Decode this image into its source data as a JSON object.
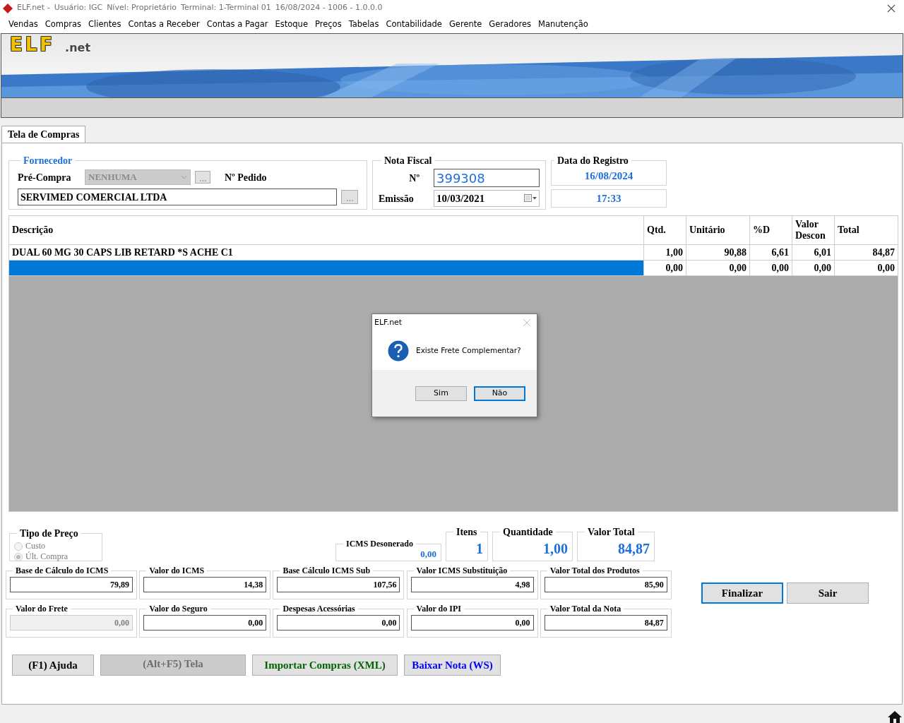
{
  "window": {
    "title_parts": [
      "ELF.net -",
      "Usuário: IGC",
      "Nível: Proprietário",
      "Terminal: 1-Terminal 01",
      "16/08/2024 - 1006 - 1.0.0.0"
    ]
  },
  "menu": [
    "Vendas",
    "Compras",
    "Clientes",
    "Contas a Receber",
    "Contas a Pagar",
    "Estoque",
    "Preços",
    "Tabelas",
    "Contabilidade",
    "Gerente",
    "Geradores",
    "Manutenção"
  ],
  "banner": {
    "logo": "ELF",
    "suffix": ".net"
  },
  "tabs": [
    {
      "label": "Tela de Compras",
      "selected": true
    }
  ],
  "fornecedor": {
    "legend": "Fornecedor",
    "pre_compra_label": "Pré-Compra",
    "pre_compra_value": "NENHUMA",
    "pre_compra_disabled": true,
    "pedido_label": "Nº Pedido",
    "supplier": "SERVIMED COMERCIAL LTDA"
  },
  "nota_fiscal": {
    "legend": "Nota Fiscal",
    "numero_label": "Nº",
    "numero": "399308",
    "emissao_label": "Emissão",
    "emissao": "10/03/2021"
  },
  "registro": {
    "legend": "Data do Registro",
    "date": "16/08/2024",
    "time": "17:33"
  },
  "table": {
    "columns": [
      "Descrição",
      "Qtd.",
      "Unitário",
      "%D",
      "Valor Descon",
      "Total"
    ],
    "rows": [
      {
        "cells": [
          "DUAL 60 MG 30 CAPS LIB RETARD *S ACHE C1",
          "1,00",
          "90,88",
          "6,61",
          "6,01",
          "84,87"
        ],
        "selected": false
      },
      {
        "cells": [
          "",
          "0,00",
          "0,00",
          "0,00",
          "0,00",
          "0,00"
        ],
        "selected": true
      }
    ]
  },
  "tipo_preco": {
    "legend": "Tipo de Preço",
    "disabled": true,
    "options": [
      {
        "label": "Custo",
        "selected": false
      },
      {
        "label": "Últ. Compra",
        "selected": true
      }
    ]
  },
  "icms_desonerado": {
    "label": "ICMS Desonerado",
    "value": "0,00"
  },
  "summary": [
    {
      "label": "Itens",
      "value": "1"
    },
    {
      "label": "Quantidade",
      "value": "1,00"
    },
    {
      "label": "Valor Total",
      "value": "84,87"
    }
  ],
  "fields": [
    {
      "label": "Base de Cálculo do ICMS",
      "value": "79,89",
      "disabled": false
    },
    {
      "label": "Valor do ICMS",
      "value": "14,38",
      "disabled": false
    },
    {
      "label": "Base Cálculo ICMS Sub",
      "value": "107,56",
      "disabled": false
    },
    {
      "label": "Valor ICMS Substituição",
      "value": "4,98",
      "disabled": false
    },
    {
      "label": "Valor Total dos Produtos",
      "value": "85,90",
      "disabled": false
    },
    {
      "label": "Valor do Frete",
      "value": "0,00",
      "disabled": true
    },
    {
      "label": "Valor do Seguro",
      "value": "0,00",
      "disabled": false
    },
    {
      "label": "Despesas Acessórias",
      "value": "0,00",
      "disabled": false
    },
    {
      "label": "Valor do IPI",
      "value": "0,00",
      "disabled": false
    },
    {
      "label": "Valor Total da Nota",
      "value": "84,87",
      "disabled": false
    }
  ],
  "actions": [
    {
      "label": "Finalizar",
      "focused": true
    },
    {
      "label": "Sair",
      "focused": false
    }
  ],
  "bottom_buttons": [
    {
      "label": "(F1) Ajuda",
      "disabled": false,
      "color": "#000000"
    },
    {
      "label": "(Alt+F5) Tela",
      "disabled": true,
      "color": "#6e6e6e"
    },
    {
      "label": "Importar Compras (XML)",
      "disabled": false,
      "color": "#006400"
    },
    {
      "label": "Baixar Nota (WS)",
      "disabled": false,
      "color": "#0000ff"
    }
  ],
  "dialog": {
    "title": "ELF.net",
    "message": "Existe Frete Complementar?",
    "buttons": [
      {
        "label": "Sim",
        "focused": false
      },
      {
        "label": "Não",
        "focused": true
      }
    ]
  }
}
